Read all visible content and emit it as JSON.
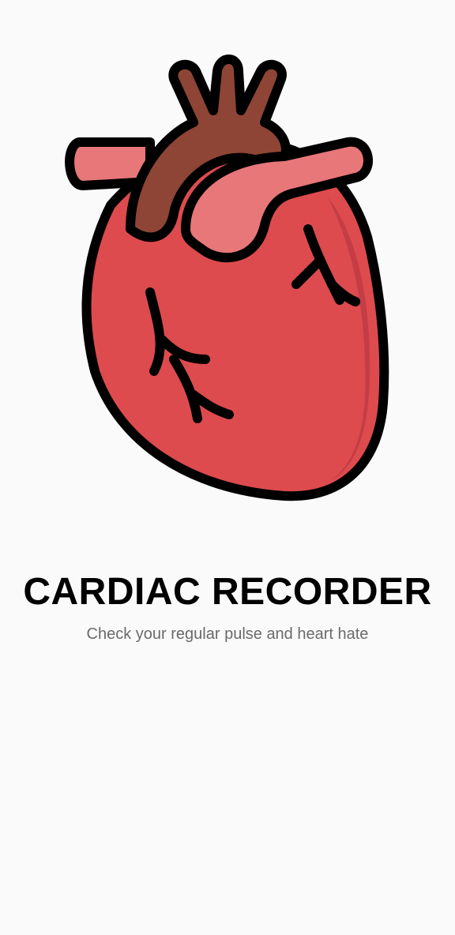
{
  "app": {
    "title": "CARDIAC RECORDER",
    "subtitle": "Check your regular pulse and heart hate"
  },
  "logo": {
    "icon": "heart-icon",
    "colors": {
      "body": "#dd4b4e",
      "body_shade": "#c43d44",
      "vessel_pink": "#e8777a",
      "aorta_brown": "#8e4535",
      "outline": "#000000"
    }
  },
  "theme": {
    "background": "#fafafa",
    "title_color": "#000000",
    "subtitle_color": "#6a6a6a"
  }
}
